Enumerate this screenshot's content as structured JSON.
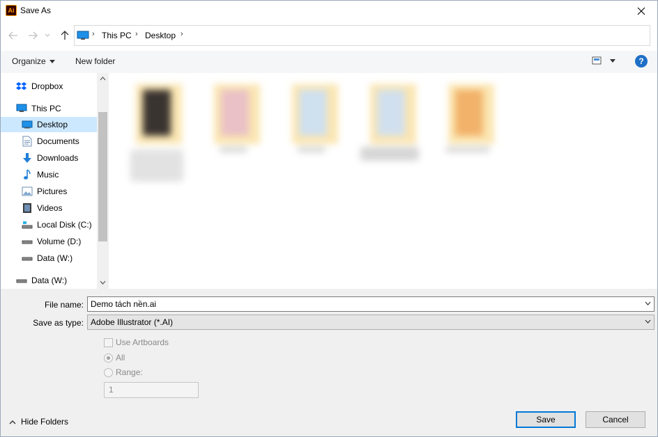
{
  "window": {
    "app_icon_text": "Ai",
    "title": "Save As"
  },
  "address_bar": {
    "crumbs": [
      "This PC",
      "Desktop"
    ]
  },
  "toolbar": {
    "organize_label": "Organize",
    "new_folder_label": "New folder"
  },
  "sidebar": {
    "items": [
      {
        "label": "Dropbox",
        "icon": "dropbox-icon"
      },
      {
        "label": "This PC",
        "icon": "computer-icon"
      },
      {
        "label": "Desktop",
        "icon": "desktop-icon",
        "selected": true
      },
      {
        "label": "Documents",
        "icon": "documents-icon"
      },
      {
        "label": "Downloads",
        "icon": "downloads-icon"
      },
      {
        "label": "Music",
        "icon": "music-icon"
      },
      {
        "label": "Pictures",
        "icon": "pictures-icon"
      },
      {
        "label": "Videos",
        "icon": "videos-icon"
      },
      {
        "label": "Local Disk (C:)",
        "icon": "local-disk-icon"
      },
      {
        "label": "Volume (D:)",
        "icon": "drive-icon"
      },
      {
        "label": "Data (W:)",
        "icon": "drive-icon"
      },
      {
        "label": "Data (W:)",
        "icon": "network-drive-icon"
      }
    ]
  },
  "form": {
    "file_name_label": "File name:",
    "file_name_value": "Demo tách nền.ai",
    "save_as_type_label": "Save as type:",
    "save_as_type_value": "Adobe Illustrator (*.AI)"
  },
  "options": {
    "use_artboards_label": "Use Artboards",
    "all_label": "All",
    "range_label": "Range:",
    "range_value": "1"
  },
  "footer": {
    "hide_folders_label": "Hide Folders",
    "save_label": "Save",
    "cancel_label": "Cancel"
  },
  "colors": {
    "accent": "#0078d7",
    "selection": "#cce8ff",
    "help": "#1e6fc6"
  }
}
